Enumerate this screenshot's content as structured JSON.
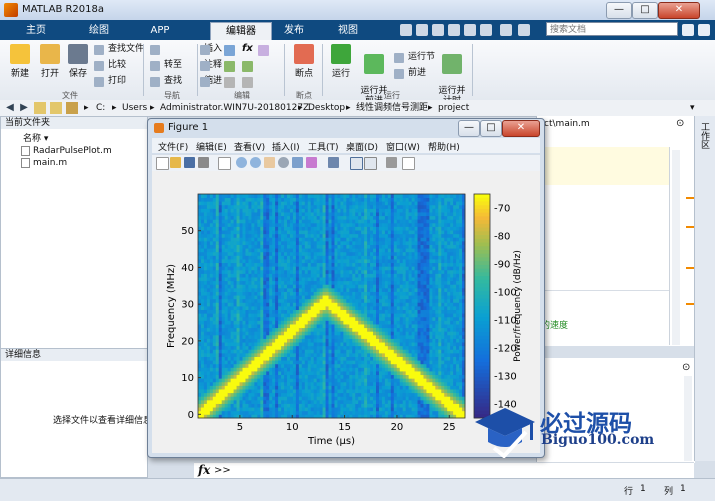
{
  "window": {
    "title": "MATLAB R2018a"
  },
  "tabs": [
    {
      "label": "主页"
    },
    {
      "label": "绘图"
    },
    {
      "label": "APP"
    },
    {
      "label": "编辑器"
    },
    {
      "label": "发布"
    },
    {
      "label": "视图"
    }
  ],
  "search": {
    "placeholder": "搜索文档"
  },
  "ribbon": {
    "file": {
      "new": "新建",
      "open": "打开",
      "save": "保存",
      "find_files": "查找文件",
      "compare": "比较",
      "print": "打印",
      "group": "文件"
    },
    "nav": {
      "goto": "转至",
      "find": "查找",
      "group": "导航"
    },
    "edit": {
      "insert": "插入",
      "comment": "注释",
      "indent": "缩进",
      "fx": "fx",
      "group": "编辑"
    },
    "breakpoints": {
      "label": "断点",
      "group": "断点"
    },
    "run": {
      "run": "运行",
      "run_advance": "运行并\n前进",
      "run_section": "运行节",
      "advance": "前进",
      "run_time": "运行并\n计时",
      "group": "运行"
    }
  },
  "address": {
    "segments": [
      "C:",
      "Users",
      "Administrator.WIN7U-20180127Z",
      "Desktop",
      "线性调频信号测距",
      "project"
    ]
  },
  "current_folder": {
    "title": "当前文件夹",
    "column": "名称 ▾",
    "files": [
      {
        "name": "RadarPulsePlot.m"
      },
      {
        "name": "main.m"
      }
    ]
  },
  "details": {
    "title": "详细信息",
    "hint": "选择文件以查看详细信息"
  },
  "editor": {
    "tab": "ject\\main.m",
    "green_comment": "的速度"
  },
  "workspace_strip": {
    "label": "工作区"
  },
  "command": {
    "fx": "fx",
    "prompt": ">>"
  },
  "status": {
    "row_label": "行",
    "row": "1",
    "col_label": "列",
    "col": "1"
  },
  "figure": {
    "title": "Figure 1",
    "menu": [
      "文件(F)",
      "编辑(E)",
      "查看(V)",
      "插入(I)",
      "工具(T)",
      "桌面(D)",
      "窗口(W)",
      "帮助(H)"
    ]
  },
  "watermark": {
    "text": "必过源码",
    "sub": "Biguo100.com"
  },
  "chart_data": {
    "type": "heatmap",
    "xlabel": "Time (μs)",
    "ylabel": "Frequency (MHz)",
    "colorbar_label": "Power/frequency (dB/Hz)",
    "x_ticks": [
      5,
      10,
      15,
      20,
      25
    ],
    "y_ticks": [
      0,
      10,
      20,
      30,
      40,
      50
    ],
    "colorbar_ticks": [
      -70,
      -80,
      -90,
      -100,
      -110,
      -120,
      -130,
      -140
    ],
    "xlim": [
      1,
      26.5
    ],
    "ylim": [
      -1,
      60
    ],
    "clim": [
      -145,
      -65
    ],
    "ridge": {
      "start": {
        "x": 1.2,
        "y": 0
      },
      "peak": {
        "x": 13.2,
        "y": 31
      },
      "end": {
        "x": 26.2,
        "y": 0
      }
    },
    "colormap": "parula"
  }
}
